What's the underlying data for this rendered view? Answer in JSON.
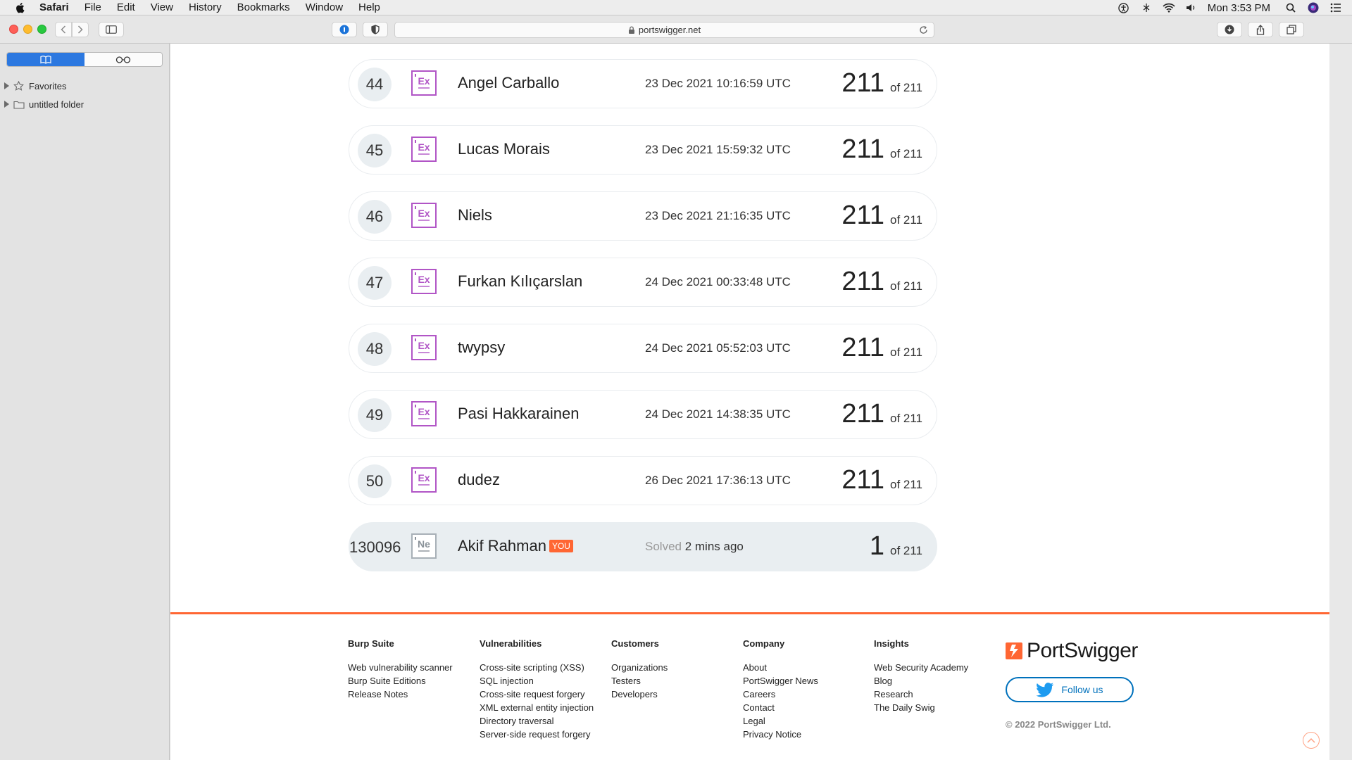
{
  "menubar": {
    "app_name": "Safari",
    "items": [
      "File",
      "Edit",
      "View",
      "History",
      "Bookmarks",
      "Window",
      "Help"
    ],
    "clock": "Mon 3:53 PM"
  },
  "toolbar": {
    "url": "portswigger.net"
  },
  "sidebar": {
    "items": [
      {
        "label": "Favorites",
        "icon": "star-icon"
      },
      {
        "label": "untitled folder",
        "icon": "folder-icon"
      }
    ]
  },
  "leaderboard": {
    "rows": [
      {
        "rank": "44",
        "badge": "Ex",
        "name": "Angel Carballo",
        "time": "23 Dec 2021 10:16:59 UTC",
        "score": "211",
        "total": "of 211"
      },
      {
        "rank": "45",
        "badge": "Ex",
        "name": "Lucas Morais",
        "time": "23 Dec 2021 15:59:32 UTC",
        "score": "211",
        "total": "of 211"
      },
      {
        "rank": "46",
        "badge": "Ex",
        "name": "Niels",
        "time": "23 Dec 2021 21:16:35 UTC",
        "score": "211",
        "total": "of 211"
      },
      {
        "rank": "47",
        "badge": "Ex",
        "name": "Furkan Kılıçarslan",
        "time": "24 Dec 2021 00:33:48 UTC",
        "score": "211",
        "total": "of 211"
      },
      {
        "rank": "48",
        "badge": "Ex",
        "name": "twypsy",
        "time": "24 Dec 2021 05:52:03 UTC",
        "score": "211",
        "total": "of 211"
      },
      {
        "rank": "49",
        "badge": "Ex",
        "name": "Pasi Hakkarainen",
        "time": "24 Dec 2021 14:38:35 UTC",
        "score": "211",
        "total": "of 211"
      },
      {
        "rank": "50",
        "badge": "Ex",
        "name": "dudez",
        "time": "26 Dec 2021 17:36:13 UTC",
        "score": "211",
        "total": "of 211"
      }
    ],
    "you": {
      "rank": "130096",
      "badge": "Ne",
      "name": "Akif Rahman",
      "tag": "YOU",
      "time_prefix": "Solved",
      "time": "2 mins ago",
      "score": "1",
      "total": "of 211"
    }
  },
  "footer": {
    "columns": [
      {
        "heading": "Burp Suite",
        "links": [
          "Web vulnerability scanner",
          "Burp Suite Editions",
          "Release Notes"
        ]
      },
      {
        "heading": "Vulnerabilities",
        "links": [
          "Cross-site scripting (XSS)",
          "SQL injection",
          "Cross-site request forgery",
          "XML external entity injection",
          "Directory traversal",
          "Server-side request forgery"
        ]
      },
      {
        "heading": "Customers",
        "links": [
          "Organizations",
          "Testers",
          "Developers"
        ]
      },
      {
        "heading": "Company",
        "links": [
          "About",
          "PortSwigger News",
          "Careers",
          "Contact",
          "Legal",
          "Privacy Notice"
        ]
      },
      {
        "heading": "Insights",
        "links": [
          "Web Security Academy",
          "Blog",
          "Research",
          "The Daily Swig"
        ]
      }
    ],
    "brand": "PortSwigger",
    "follow_label": "Follow us",
    "copyright": "© 2022 PortSwigger Ltd."
  },
  "colors": {
    "accent": "#ff6633",
    "expert_badge": "#b155c6",
    "twitter_blue": "#0071bc"
  }
}
